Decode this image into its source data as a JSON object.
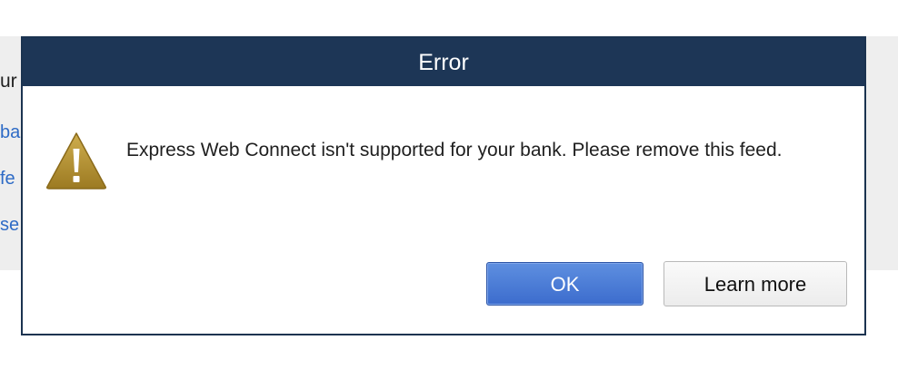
{
  "background": {
    "heading_fragment": "ur",
    "link_fragments": [
      "ba",
      "fe",
      "se"
    ]
  },
  "dialog": {
    "title": "Error",
    "icon": "warning-triangle-icon",
    "message": "Express Web Connect isn't supported for your bank. Please remove this feed.",
    "buttons": {
      "ok_label": "OK",
      "learn_more_label": "Learn more"
    }
  },
  "colors": {
    "titlebar": "#1d3656",
    "ok_button": "#4a7bd6",
    "warning_icon": "#b8922e",
    "background_link": "#2e6bc6"
  }
}
